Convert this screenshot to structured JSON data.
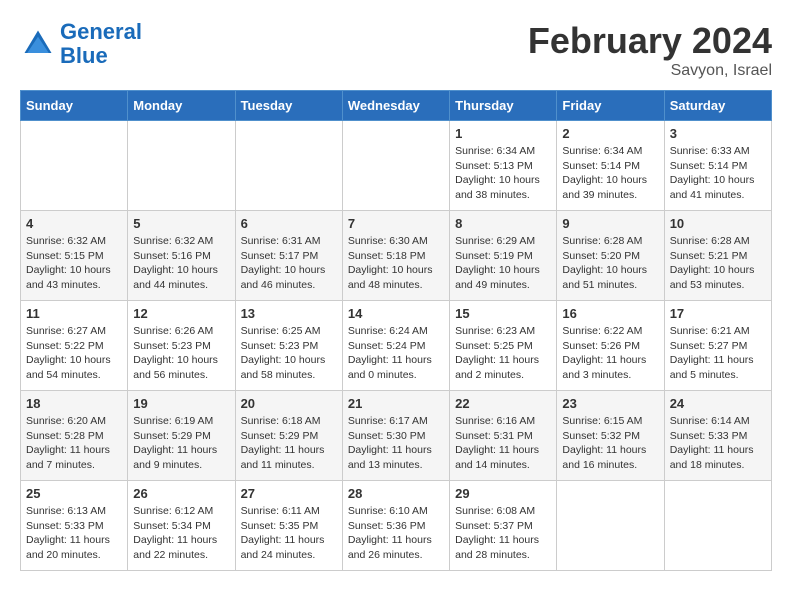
{
  "logo": {
    "text_general": "General",
    "text_blue": "Blue"
  },
  "header": {
    "title": "February 2024",
    "subtitle": "Savyon, Israel"
  },
  "weekdays": [
    "Sunday",
    "Monday",
    "Tuesday",
    "Wednesday",
    "Thursday",
    "Friday",
    "Saturday"
  ],
  "weeks": [
    [
      {
        "day": "",
        "info": ""
      },
      {
        "day": "",
        "info": ""
      },
      {
        "day": "",
        "info": ""
      },
      {
        "day": "",
        "info": ""
      },
      {
        "day": "1",
        "info": "Sunrise: 6:34 AM\nSunset: 5:13 PM\nDaylight: 10 hours\nand 38 minutes."
      },
      {
        "day": "2",
        "info": "Sunrise: 6:34 AM\nSunset: 5:14 PM\nDaylight: 10 hours\nand 39 minutes."
      },
      {
        "day": "3",
        "info": "Sunrise: 6:33 AM\nSunset: 5:14 PM\nDaylight: 10 hours\nand 41 minutes."
      }
    ],
    [
      {
        "day": "4",
        "info": "Sunrise: 6:32 AM\nSunset: 5:15 PM\nDaylight: 10 hours\nand 43 minutes."
      },
      {
        "day": "5",
        "info": "Sunrise: 6:32 AM\nSunset: 5:16 PM\nDaylight: 10 hours\nand 44 minutes."
      },
      {
        "day": "6",
        "info": "Sunrise: 6:31 AM\nSunset: 5:17 PM\nDaylight: 10 hours\nand 46 minutes."
      },
      {
        "day": "7",
        "info": "Sunrise: 6:30 AM\nSunset: 5:18 PM\nDaylight: 10 hours\nand 48 minutes."
      },
      {
        "day": "8",
        "info": "Sunrise: 6:29 AM\nSunset: 5:19 PM\nDaylight: 10 hours\nand 49 minutes."
      },
      {
        "day": "9",
        "info": "Sunrise: 6:28 AM\nSunset: 5:20 PM\nDaylight: 10 hours\nand 51 minutes."
      },
      {
        "day": "10",
        "info": "Sunrise: 6:28 AM\nSunset: 5:21 PM\nDaylight: 10 hours\nand 53 minutes."
      }
    ],
    [
      {
        "day": "11",
        "info": "Sunrise: 6:27 AM\nSunset: 5:22 PM\nDaylight: 10 hours\nand 54 minutes."
      },
      {
        "day": "12",
        "info": "Sunrise: 6:26 AM\nSunset: 5:23 PM\nDaylight: 10 hours\nand 56 minutes."
      },
      {
        "day": "13",
        "info": "Sunrise: 6:25 AM\nSunset: 5:23 PM\nDaylight: 10 hours\nand 58 minutes."
      },
      {
        "day": "14",
        "info": "Sunrise: 6:24 AM\nSunset: 5:24 PM\nDaylight: 11 hours\nand 0 minutes."
      },
      {
        "day": "15",
        "info": "Sunrise: 6:23 AM\nSunset: 5:25 PM\nDaylight: 11 hours\nand 2 minutes."
      },
      {
        "day": "16",
        "info": "Sunrise: 6:22 AM\nSunset: 5:26 PM\nDaylight: 11 hours\nand 3 minutes."
      },
      {
        "day": "17",
        "info": "Sunrise: 6:21 AM\nSunset: 5:27 PM\nDaylight: 11 hours\nand 5 minutes."
      }
    ],
    [
      {
        "day": "18",
        "info": "Sunrise: 6:20 AM\nSunset: 5:28 PM\nDaylight: 11 hours\nand 7 minutes."
      },
      {
        "day": "19",
        "info": "Sunrise: 6:19 AM\nSunset: 5:29 PM\nDaylight: 11 hours\nand 9 minutes."
      },
      {
        "day": "20",
        "info": "Sunrise: 6:18 AM\nSunset: 5:29 PM\nDaylight: 11 hours\nand 11 minutes."
      },
      {
        "day": "21",
        "info": "Sunrise: 6:17 AM\nSunset: 5:30 PM\nDaylight: 11 hours\nand 13 minutes."
      },
      {
        "day": "22",
        "info": "Sunrise: 6:16 AM\nSunset: 5:31 PM\nDaylight: 11 hours\nand 14 minutes."
      },
      {
        "day": "23",
        "info": "Sunrise: 6:15 AM\nSunset: 5:32 PM\nDaylight: 11 hours\nand 16 minutes."
      },
      {
        "day": "24",
        "info": "Sunrise: 6:14 AM\nSunset: 5:33 PM\nDaylight: 11 hours\nand 18 minutes."
      }
    ],
    [
      {
        "day": "25",
        "info": "Sunrise: 6:13 AM\nSunset: 5:33 PM\nDaylight: 11 hours\nand 20 minutes."
      },
      {
        "day": "26",
        "info": "Sunrise: 6:12 AM\nSunset: 5:34 PM\nDaylight: 11 hours\nand 22 minutes."
      },
      {
        "day": "27",
        "info": "Sunrise: 6:11 AM\nSunset: 5:35 PM\nDaylight: 11 hours\nand 24 minutes."
      },
      {
        "day": "28",
        "info": "Sunrise: 6:10 AM\nSunset: 5:36 PM\nDaylight: 11 hours\nand 26 minutes."
      },
      {
        "day": "29",
        "info": "Sunrise: 6:08 AM\nSunset: 5:37 PM\nDaylight: 11 hours\nand 28 minutes."
      },
      {
        "day": "",
        "info": ""
      },
      {
        "day": "",
        "info": ""
      }
    ]
  ]
}
